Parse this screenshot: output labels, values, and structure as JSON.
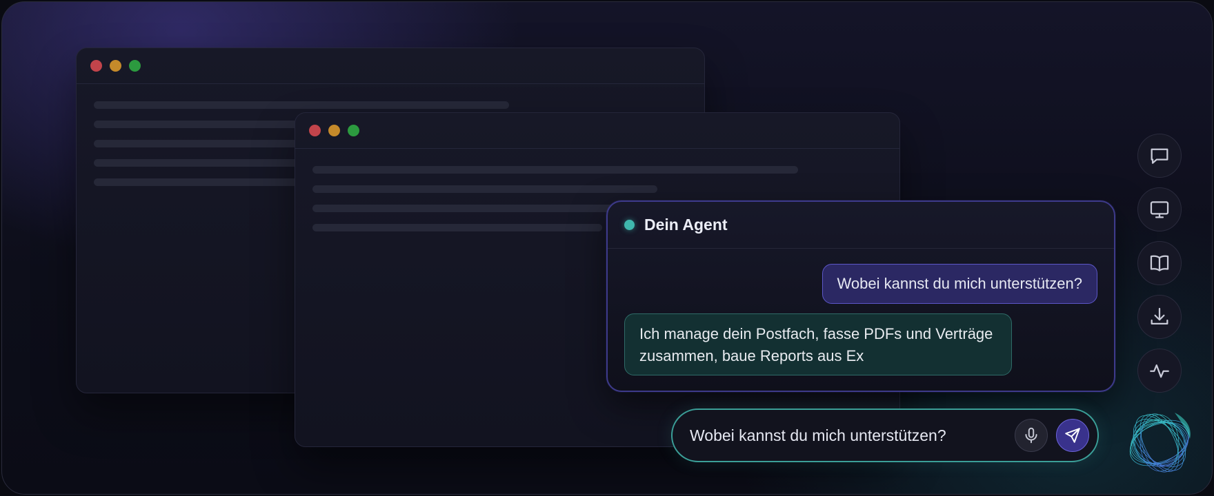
{
  "agent": {
    "title": "Dein Agent",
    "status_color": "#3fb8ad"
  },
  "conversation": {
    "user_message": "Wobei kannst du mich unterstützen?",
    "agent_message": "Ich manage dein Postfach, fasse PDFs und Verträge zusammen, baue Reports aus Ex"
  },
  "composer": {
    "value": "Wobei kannst du mich unterstützen?",
    "mic_icon": "mic-icon",
    "send_icon": "send-icon"
  },
  "side_rail": {
    "icons": [
      "chat-icon",
      "monitor-icon",
      "book-icon",
      "download-icon",
      "activity-icon"
    ]
  },
  "colors": {
    "accent_purple": "#5d57c9",
    "accent_teal": "#3b9f98",
    "window_red": "#c2444b",
    "window_yellow": "#c58a2a",
    "window_green": "#2c9a3f"
  }
}
